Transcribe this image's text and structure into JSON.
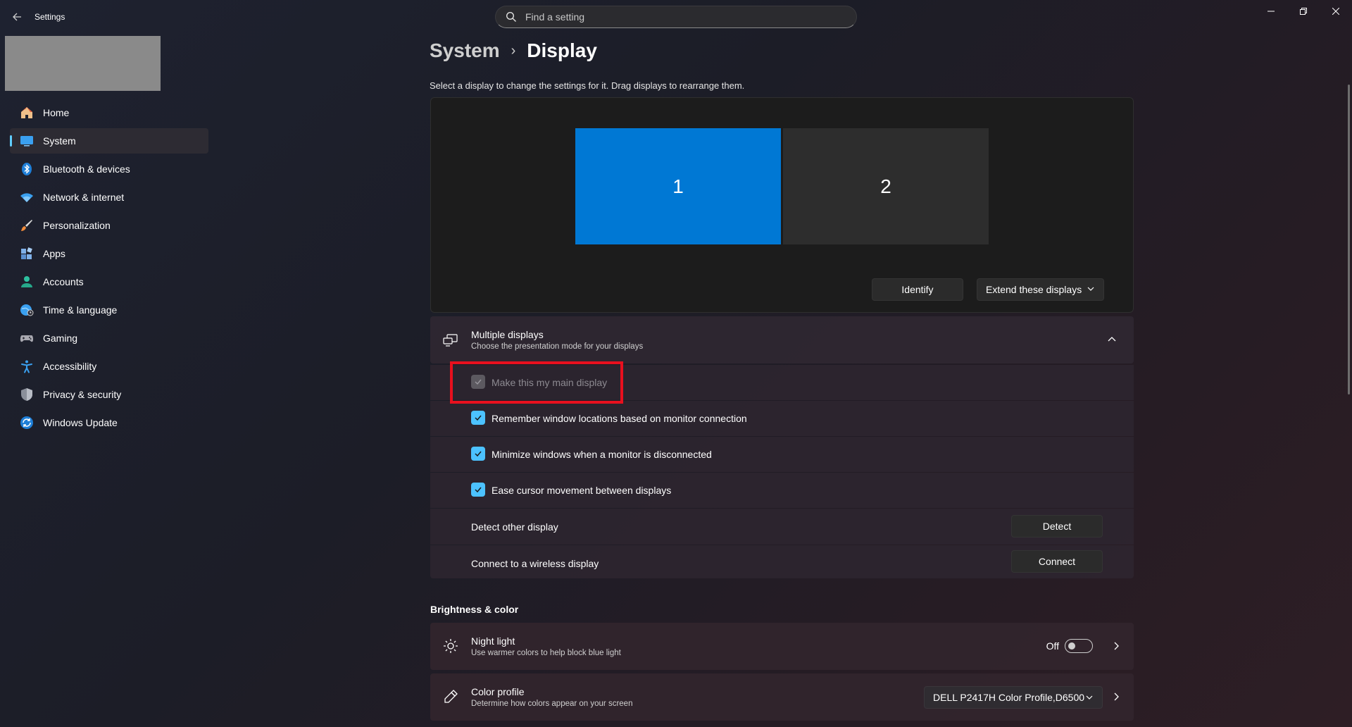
{
  "app": {
    "title": "Settings"
  },
  "search": {
    "placeholder": "Find a setting"
  },
  "sidebar": {
    "items": [
      {
        "label": "Home",
        "icon": "home-icon"
      },
      {
        "label": "System",
        "icon": "system-icon",
        "active": true
      },
      {
        "label": "Bluetooth & devices",
        "icon": "bluetooth-icon"
      },
      {
        "label": "Network & internet",
        "icon": "wifi-icon"
      },
      {
        "label": "Personalization",
        "icon": "brush-icon"
      },
      {
        "label": "Apps",
        "icon": "apps-icon"
      },
      {
        "label": "Accounts",
        "icon": "person-icon"
      },
      {
        "label": "Time & language",
        "icon": "globe-clock-icon"
      },
      {
        "label": "Gaming",
        "icon": "gamepad-icon"
      },
      {
        "label": "Accessibility",
        "icon": "accessibility-icon"
      },
      {
        "label": "Privacy & security",
        "icon": "shield-icon"
      },
      {
        "label": "Windows Update",
        "icon": "update-icon"
      }
    ]
  },
  "breadcrumb": {
    "parent": "System",
    "separator": "›",
    "current": "Display"
  },
  "intro": "Select a display to change the settings for it. Drag displays to rearrange them.",
  "displays": {
    "monitor_1": "1",
    "monitor_2": "2",
    "identify_label": "Identify",
    "mode_label": "Extend these displays"
  },
  "multiple_displays": {
    "title": "Multiple displays",
    "subtitle": "Choose the presentation mode for your displays",
    "options": [
      {
        "label": "Make this my main display",
        "checked": true,
        "disabled": true
      },
      {
        "label": "Remember window locations based on monitor connection",
        "checked": true
      },
      {
        "label": "Minimize windows when a monitor is disconnected",
        "checked": true
      },
      {
        "label": "Ease cursor movement between displays",
        "checked": true
      }
    ],
    "detect": {
      "label": "Detect other display",
      "button": "Detect"
    },
    "connect": {
      "label": "Connect to a wireless display",
      "button": "Connect"
    }
  },
  "brightness_color": {
    "title": "Brightness & color",
    "night_light": {
      "title": "Night light",
      "subtitle": "Use warmer colors to help block blue light",
      "state": "Off"
    },
    "color_profile": {
      "title": "Color profile",
      "subtitle": "Determine how colors appear on your screen",
      "value": "DELL P2417H Color Profile,D6500"
    }
  },
  "colors": {
    "accent": "#0078d4",
    "checkbox": "#4cc2ff",
    "highlight": "#e8101e"
  }
}
